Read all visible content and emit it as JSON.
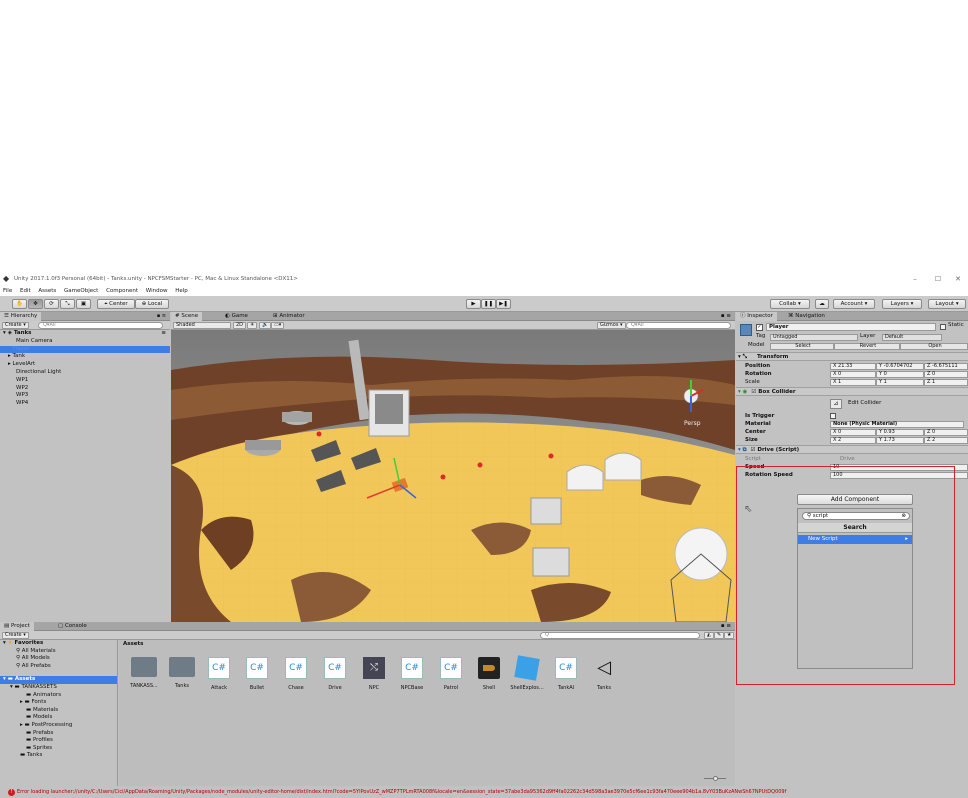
{
  "window": {
    "title": "Unity 2017.1.0f3 Personal (64bit) - Tanks.unity - NPCFSMStarter - PC, Mac & Linux Standalone <DX11>",
    "controls": [
      "–",
      "☐",
      "✕"
    ]
  },
  "menu": [
    "File",
    "Edit",
    "Assets",
    "GameObject",
    "Component",
    "Window",
    "Help"
  ],
  "toolbar": {
    "tools": [
      "✋",
      "✥",
      "⟳",
      "⤡",
      "▣"
    ],
    "pivot": "Center",
    "space": "Local",
    "play": "▶",
    "pause": "❚❚",
    "step": "▶❚",
    "collab": "Collab ▾",
    "cloud": "☁",
    "account": "Account ▾",
    "layers": "Layers ▾",
    "layout": "Layout ▾"
  },
  "hierarchy": {
    "tab": "Hierarchy",
    "create": "Create ▾",
    "search_placeholder": "Q▾All",
    "scene": "Tanks",
    "items": [
      "Main Camera",
      "Player",
      "Tank",
      "LevelArt",
      "Directional Light",
      "WP1",
      "WP2",
      "WP3",
      "WP4"
    ]
  },
  "scene_view": {
    "tabs": [
      "Scene",
      "Game",
      "Animator"
    ],
    "shading": "Shaded",
    "mode_2d": "2D",
    "gizmos": "Gizmos ▾",
    "search_placeholder": "Q▾All",
    "persp": "Persp"
  },
  "inspector": {
    "tabs": [
      "Inspector",
      "Navigation"
    ],
    "object_name": "Player",
    "static_label": "Static",
    "tag_label": "Tag",
    "tag_value": "Untagged",
    "layer_label": "Layer",
    "layer_value": "Default",
    "model_label": "Model",
    "model_buttons": [
      "Select",
      "Revert",
      "Open"
    ],
    "transform": {
      "title": "Transform",
      "position_label": "Position",
      "rotation_label": "Rotation",
      "scale_label": "Scale",
      "position": [
        "X 21.33",
        "Y -0.6704702",
        "Z -6.675111"
      ],
      "rotation": [
        "X 0",
        "Y 0",
        "Z 0"
      ],
      "scale": [
        "X 1",
        "Y 1",
        "Z 1"
      ]
    },
    "box_collider": {
      "title": "Box Collider",
      "edit_collider": "Edit Collider",
      "is_trigger_label": "Is Trigger",
      "material_label": "Material",
      "material_value": "None (Physic Material)",
      "center_label": "Center",
      "size_label": "Size",
      "center": [
        "X 0",
        "Y 0.93",
        "Z 0"
      ],
      "size": [
        "X 2",
        "Y 1.73",
        "Z 2"
      ]
    },
    "drive": {
      "title": "Drive (Script)",
      "script_label": "Script",
      "script_value": "Drive",
      "speed_label": "Speed",
      "speed_value": "10",
      "rotation_speed_label": "Rotation Speed",
      "rotation_speed_value": "100"
    },
    "add_component": "Add Component",
    "dropdown": {
      "search_value": "script",
      "header": "Search",
      "items": [
        "New Script"
      ]
    }
  },
  "project": {
    "tabs": [
      "Project",
      "Console"
    ],
    "create": "Create ▾",
    "search_placeholder": "Q",
    "favorites_label": "Favorites",
    "favorites": [
      "All Materials",
      "All Models",
      "All Prefabs"
    ],
    "assets_label": "Assets",
    "tree": [
      "TANKASSETS",
      "Animators",
      "Fonts",
      "Materials",
      "Models",
      "PostProcessing",
      "Prefabs",
      "Profiles",
      "Sprites",
      "Tanks"
    ],
    "breadcrumb": "Assets",
    "assets": [
      "TANKASS...",
      "Tanks",
      "Attack",
      "Bullet",
      "Chase",
      "Drive",
      "NPC",
      "NPCBase",
      "Patrol",
      "Shell",
      "ShellExplos...",
      "TankAI",
      "Tanks"
    ]
  },
  "status_bar": {
    "text": "Error loading launcher://unity/C:/Users/Cici/AppData/Roaming/Unity/Packages/node_modules/unity-editor-home/dist/index.html?code=5YIPovUzZ_wMZP7TPLmRTA008f&locale=en&session_state=37abe3da95362d9ff4fa02262c34d598a3ae3970e5cf6ee1c93fa470eee904b1a.8vY03BuKzANwSh67NPUtDQ009f"
  },
  "colors": {
    "selection": "#3e7de6",
    "highlight_box": "#d1232a",
    "sand": "#f1c75a",
    "rock": "#7a4a2c"
  }
}
